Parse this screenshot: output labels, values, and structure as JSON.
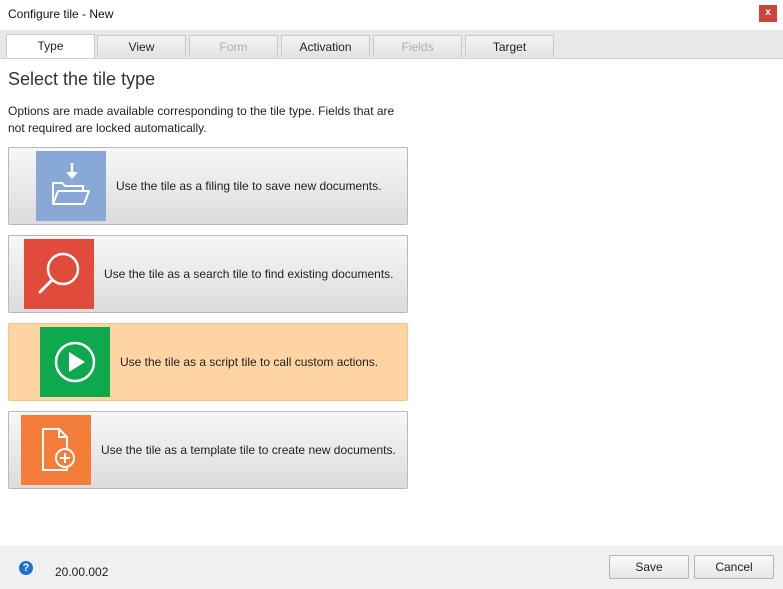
{
  "window": {
    "title": "Configure tile - New",
    "close_glyph": "x"
  },
  "tabs": [
    {
      "label": "Type",
      "state": "active"
    },
    {
      "label": "View",
      "state": "enabled"
    },
    {
      "label": "Form",
      "state": "disabled"
    },
    {
      "label": "Activation",
      "state": "enabled"
    },
    {
      "label": "Fields",
      "state": "disabled"
    },
    {
      "label": "Target",
      "state": "enabled"
    }
  ],
  "main": {
    "heading": "Select the tile type",
    "description": "Options are made available corresponding to the tile type. Fields that are not required are locked automatically."
  },
  "tile_types": [
    {
      "label": "Use the tile as a filing tile to save new documents.",
      "icon": "filing-folder-icon",
      "color": "#88a9d8",
      "selected": false
    },
    {
      "label": "Use the tile as a search tile to find existing documents.",
      "icon": "magnifier-icon",
      "color": "#e04b3c",
      "selected": false
    },
    {
      "label": "Use the tile as a script tile to call custom actions.",
      "icon": "play-icon",
      "color": "#10a84c",
      "selected": true
    },
    {
      "label": "Use the tile as a template tile to create new documents.",
      "icon": "new-document-icon",
      "color": "#f57d3a",
      "selected": false
    }
  ],
  "colors": {
    "selected_card": "#ffd4a3",
    "close_button": "#c9463d",
    "help_icon": "#1d6fd1"
  },
  "footer": {
    "help_glyph": "?",
    "version": "20.00.002",
    "save_label": "Save",
    "cancel_label": "Cancel"
  }
}
